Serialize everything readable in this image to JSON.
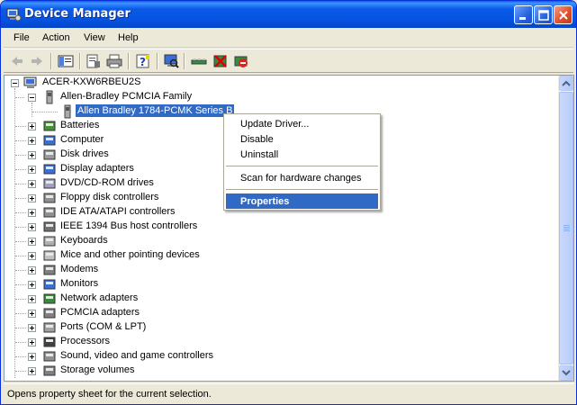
{
  "window": {
    "title": "Device Manager"
  },
  "menu": [
    "File",
    "Action",
    "View",
    "Help"
  ],
  "toolbar": {
    "buttons": [
      "back-icon",
      "forward-icon",
      "show-hide-console-tree-icon",
      "properties-icon",
      "print-icon",
      "help-icon",
      "scan-hardware-icon",
      "update-driver-icon",
      "uninstall-icon",
      "disable-icon"
    ]
  },
  "tree": {
    "root": "ACER-KXW6RBEU2S",
    "expanded_category": "Allen-Bradley PCMCIA Family",
    "selected_device": "Allen Bradley 1784-PCMK Series B",
    "categories": [
      "Batteries",
      "Computer",
      "Disk drives",
      "Display adapters",
      "DVD/CD-ROM drives",
      "Floppy disk controllers",
      "IDE ATA/ATAPI controllers",
      "IEEE 1394 Bus host controllers",
      "Keyboards",
      "Mice and other pointing devices",
      "Modems",
      "Monitors",
      "Network adapters",
      "PCMCIA adapters",
      "Ports (COM & LPT)",
      "Processors",
      "Sound, video and game controllers",
      "Storage volumes"
    ]
  },
  "context_menu": {
    "items": [
      "Update Driver...",
      "Disable",
      "Uninstall"
    ],
    "scan": "Scan for hardware changes",
    "properties": "Properties"
  },
  "status": "Opens property sheet for the current selection.",
  "colors": {
    "titlebar": "#0a5ae8",
    "selection": "#316ac5",
    "window_bg": "#ece9d8"
  }
}
